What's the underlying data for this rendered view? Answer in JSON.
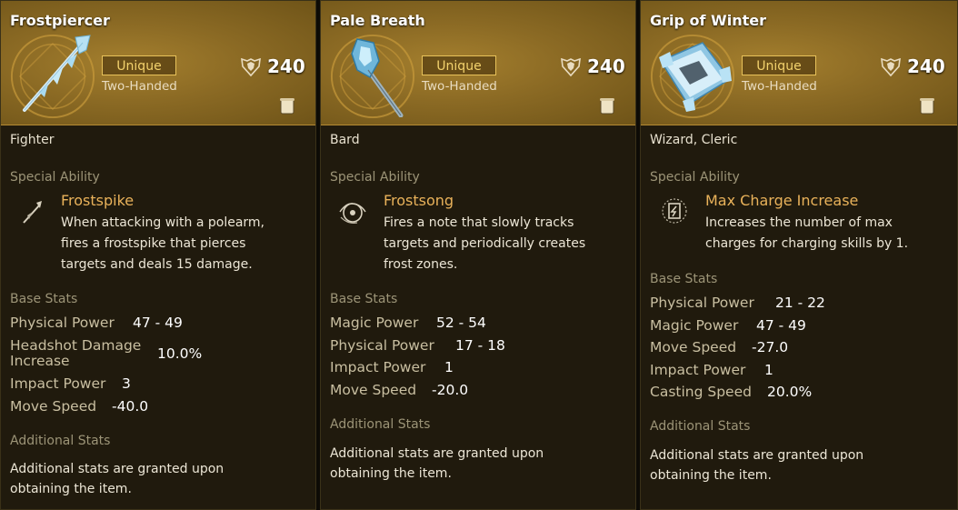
{
  "cards": [
    {
      "title": "Frostpiercer",
      "rarity": "Unique",
      "hand_type": "Two-Handed",
      "gear_score": "240",
      "classes": "Fighter",
      "special_ability_label": "Special Ability",
      "ability": {
        "name": "Frostspike",
        "desc": [
          "When attacking with a polearm,",
          "fires a frostspike that pierces",
          "targets and deals 15 damage."
        ],
        "icon": "frostspike-icon"
      },
      "base_stats_label": "Base Stats",
      "stats": [
        {
          "name": "Physical Power",
          "value": "47 - 49"
        },
        {
          "name": "Headshot Damage Increase",
          "value": "10.0%"
        },
        {
          "name": "Impact Power",
          "value": "3"
        },
        {
          "name": "Move Speed",
          "value": "-40.0"
        }
      ],
      "additional_label": "Additional Stats",
      "additional_text": [
        "Additional stats are granted upon",
        "obtaining the item."
      ],
      "item_icon": "polearm-icon"
    },
    {
      "title": "Pale Breath",
      "rarity": "Unique",
      "hand_type": "Two-Handed",
      "gear_score": "240",
      "classes": "Bard",
      "special_ability_label": "Special Ability",
      "ability": {
        "name": "Frostsong",
        "desc": [
          "Fires a note that slowly tracks",
          "targets and periodically creates",
          "frost zones."
        ],
        "icon": "frostsong-icon"
      },
      "base_stats_label": "Base Stats",
      "stats": [
        {
          "name": "Magic Power",
          "value": "52 - 54"
        },
        {
          "name": "Physical Power",
          "value": "17 - 18"
        },
        {
          "name": "Impact Power",
          "value": "1"
        },
        {
          "name": "Move Speed",
          "value": "-20.0"
        }
      ],
      "additional_label": "Additional Stats",
      "additional_text": [
        "Additional stats are granted upon",
        "obtaining the item."
      ],
      "item_icon": "ice-mace-icon"
    },
    {
      "title": "Grip of Winter",
      "rarity": "Unique",
      "hand_type": "Two-Handed",
      "gear_score": "240",
      "classes": "Wizard, Cleric",
      "special_ability_label": "Special Ability",
      "ability": {
        "name": "Max Charge Increase",
        "desc": [
          "Increases the number of max",
          "charges for charging skills by 1."
        ],
        "icon": "charge-icon"
      },
      "base_stats_label": "Base Stats",
      "stats": [
        {
          "name": "Physical Power",
          "value": "21 - 22"
        },
        {
          "name": "Magic Power",
          "value": "47 - 49"
        },
        {
          "name": "Move Speed",
          "value": "-27.0"
        },
        {
          "name": "Impact Power",
          "value": "1"
        },
        {
          "name": "Casting Speed",
          "value": "20.0%"
        }
      ],
      "additional_label": "Additional Stats",
      "additional_text": [
        "Additional stats are granted upon",
        "obtaining the item."
      ],
      "item_icon": "ice-tome-icon"
    }
  ]
}
